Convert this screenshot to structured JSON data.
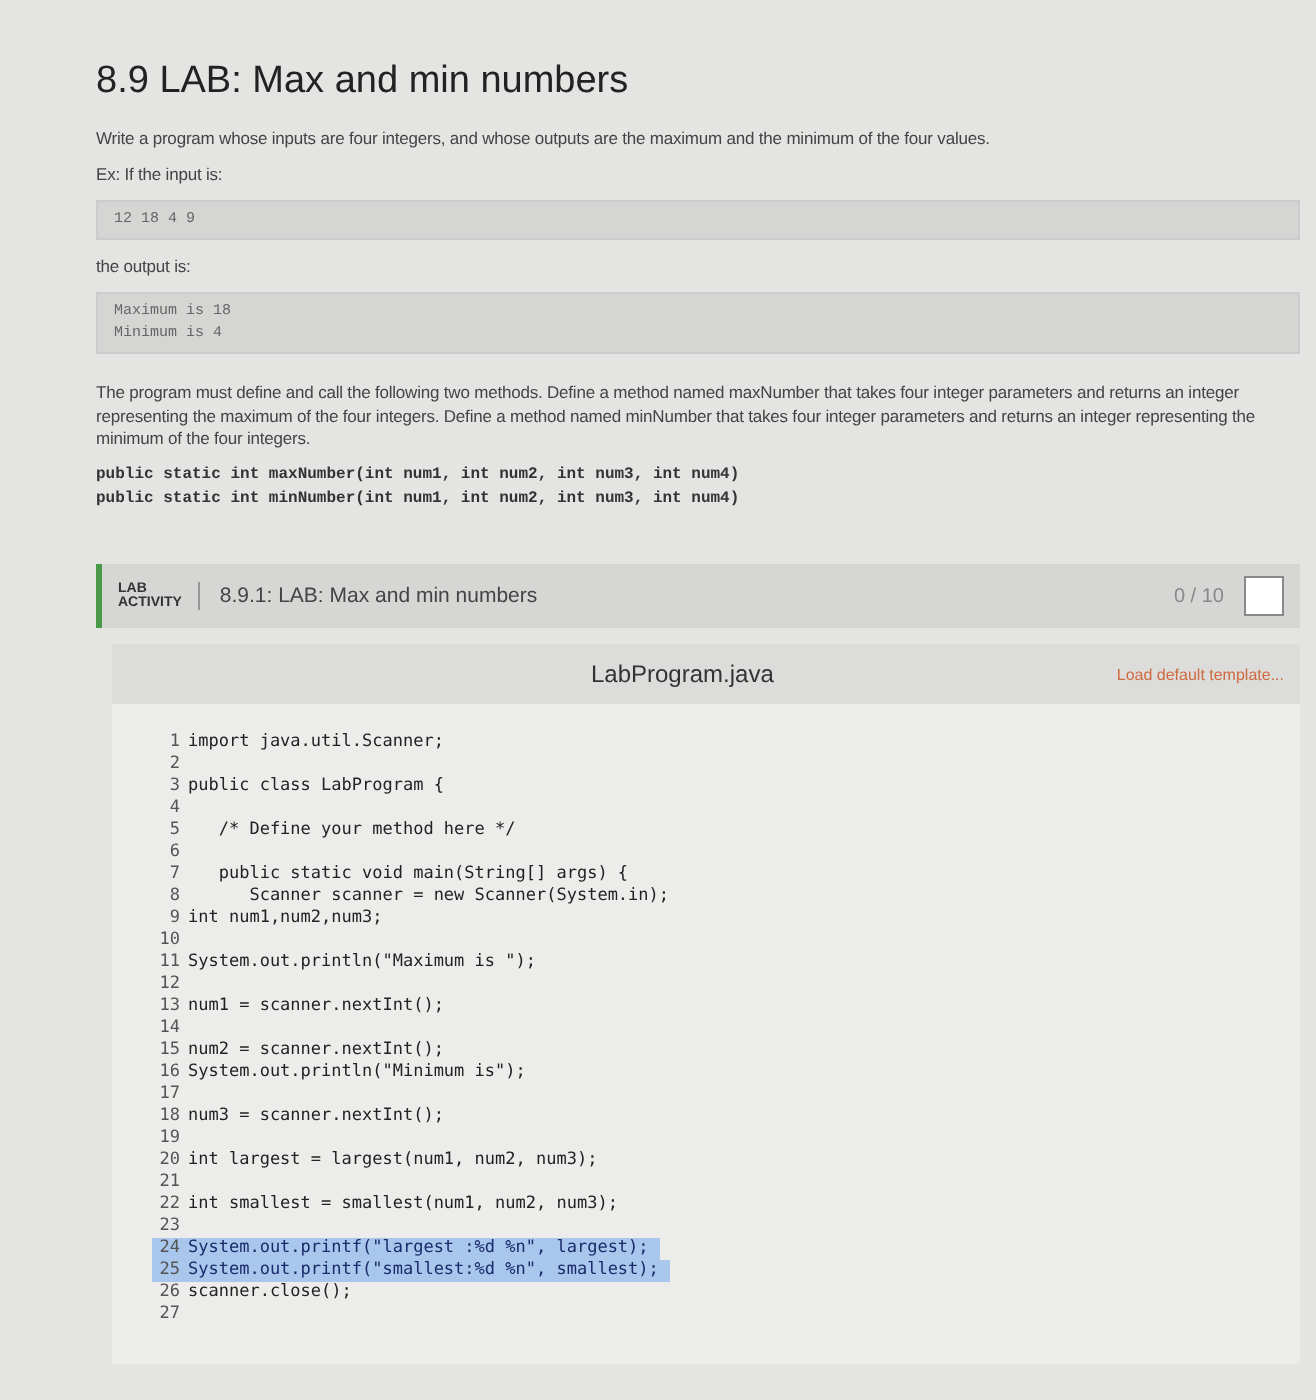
{
  "title": "8.9 LAB: Max and min numbers",
  "intro": "Write a program whose inputs are four integers, and whose outputs are the maximum and the minimum of the four values.",
  "example_label": "Ex: If the input is:",
  "input_block": [
    "12 18 4 9"
  ],
  "output_label": "the output is:",
  "output_block": [
    "Maximum is 18",
    "Minimum is 4"
  ],
  "description": "The program must define and call the following two methods. Define a method named maxNumber that takes four integer parameters and returns an integer representing the maximum of the four integers. Define a method named minNumber that takes four integer parameters and returns an integer representing the minimum of the four integers.",
  "signatures": [
    "public static int maxNumber(int num1, int num2, int num3, int num4)",
    "public static int minNumber(int num1, int num2, int num3, int num4)"
  ],
  "lab": {
    "badge_top": "LAB",
    "badge_bottom": "ACTIVITY",
    "title": "8.9.1: LAB: Max and min numbers",
    "score": "0 / 10",
    "completed": false
  },
  "editor": {
    "filename": "LabProgram.java",
    "load_template": "Load default template...",
    "lines": [
      {
        "number": "1",
        "code": "import java.util.Scanner;",
        "selected": false
      },
      {
        "number": "2",
        "selected": false
      },
      {
        "number": "3",
        "code": "public class LabProgram {",
        "selected": false
      },
      {
        "number": "4",
        "selected": false
      },
      {
        "number": "5",
        "code": "   /* Define your method here */",
        "selected": false
      },
      {
        "number": "6",
        "selected": false
      },
      {
        "number": "7",
        "code": "   public static void main(String[] args) {",
        "selected": false
      },
      {
        "number": "8",
        "code": "      Scanner scanner = new Scanner(System.in);",
        "selected": false
      },
      {
        "number": "9",
        "code": "int num1,num2,num3;",
        "selected": false
      },
      {
        "number": "10",
        "selected": false
      },
      {
        "number": "11",
        "code": "System.out.println(\"Maximum is \");",
        "selected": false
      },
      {
        "number": "12",
        "selected": false
      },
      {
        "number": "13",
        "code": "num1 = scanner.nextInt();",
        "selected": false
      },
      {
        "number": "14",
        "selected": false
      },
      {
        "number": "15",
        "code": "num2 = scanner.nextInt();",
        "selected": false
      },
      {
        "number": "16",
        "code": "System.out.println(\"Minimum is\");",
        "selected": false
      },
      {
        "number": "17",
        "selected": false
      },
      {
        "number": "18",
        "code": "num3 = scanner.nextInt();",
        "selected": false
      },
      {
        "number": "19",
        "selected": false
      },
      {
        "number": "20",
        "code": "int largest = largest(num1, num2, num3);",
        "selected": false
      },
      {
        "number": "21",
        "selected": false
      },
      {
        "number": "22",
        "code": "int smallest = smallest(num1, num2, num3);",
        "selected": false
      },
      {
        "number": "23",
        "selected": false
      },
      {
        "number": "24",
        "code": "System.out.printf(\"largest :%d %n\", largest);",
        "selected": true
      },
      {
        "number": "25",
        "code": "System.out.printf(\"smallest:%d %n\", smallest);",
        "selected": true
      },
      {
        "number": "26",
        "code": "scanner.close();",
        "selected": false
      },
      {
        "number": "27",
        "selected": false
      }
    ]
  }
}
